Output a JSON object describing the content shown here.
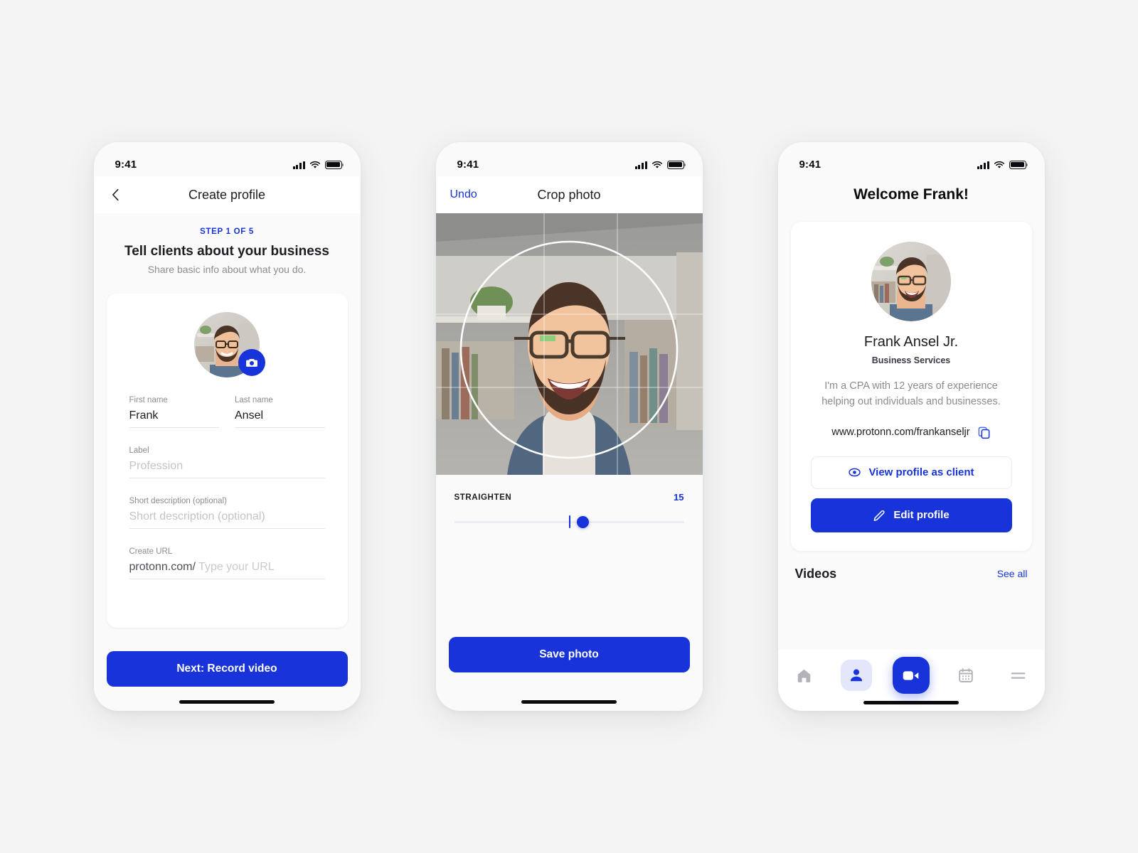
{
  "theme": {
    "accent": "#1733d9",
    "page_bg": "#f4f4f4",
    "card_bg": "#ffffff",
    "muted": "#8b8b93"
  },
  "status_bar": {
    "time": "9:41",
    "signal_icon": "cellular-bars-icon",
    "wifi_icon": "wifi-icon",
    "battery_icon": "battery-full-icon"
  },
  "screen1": {
    "nav": {
      "back_icon": "chevron-left-icon",
      "title": "Create profile"
    },
    "step_label": "STEP 1 OF 5",
    "title": "Tell clients about your business",
    "subtitle": "Share basic info about what you do.",
    "avatar": {
      "name": "profile-avatar",
      "badge_icon": "camera-icon"
    },
    "fields": [
      {
        "label": "First name",
        "value": "Frank",
        "placeholder": "First name",
        "is_placeholder": false
      },
      {
        "label": "Last name",
        "value": "Ansel",
        "placeholder": "Last name",
        "is_placeholder": false
      },
      {
        "label": "Label",
        "value": "Profession",
        "placeholder": "Profession",
        "is_placeholder": true
      },
      {
        "label": "Short description (optional)",
        "value": "Short description (optional)",
        "placeholder": "Short description (optional)",
        "is_placeholder": true
      }
    ],
    "url_field": {
      "label": "Create URL",
      "prefix": "protonn.com/",
      "placeholder": "Type your URL"
    },
    "cta": "Next: Record video"
  },
  "screen2": {
    "nav": {
      "undo": "Undo",
      "title": "Crop photo"
    },
    "crop": {
      "shape": "circle",
      "grid": "rule-of-thirds"
    },
    "straighten": {
      "label": "STRAIGHTEN",
      "value": "15",
      "min": "-45",
      "max": "45"
    },
    "cta": "Save photo"
  },
  "screen3": {
    "welcome": "Welcome Frank!",
    "name": "Frank Ansel Jr.",
    "role": "Business Services",
    "bio": "I'm a CPA with 12 years of experience helping out individuals and businesses.",
    "url": "www.protonn.com/frankanseljr",
    "copy_icon": "copy-icon",
    "view_button": {
      "label": "View profile as client",
      "icon": "eye-icon"
    },
    "edit_button": {
      "label": "Edit profile",
      "icon": "pencil-icon"
    },
    "videos_section": {
      "title": "Videos",
      "see_all": "See all"
    },
    "tabs": [
      {
        "name": "home",
        "icon": "home-icon",
        "active": false
      },
      {
        "name": "profile",
        "icon": "person-icon",
        "active": true
      },
      {
        "name": "record",
        "icon": "video-camera-icon",
        "active": false
      },
      {
        "name": "calendar",
        "icon": "calendar-icon",
        "active": false
      },
      {
        "name": "menu",
        "icon": "hamburger-menu-icon",
        "active": false
      }
    ]
  }
}
